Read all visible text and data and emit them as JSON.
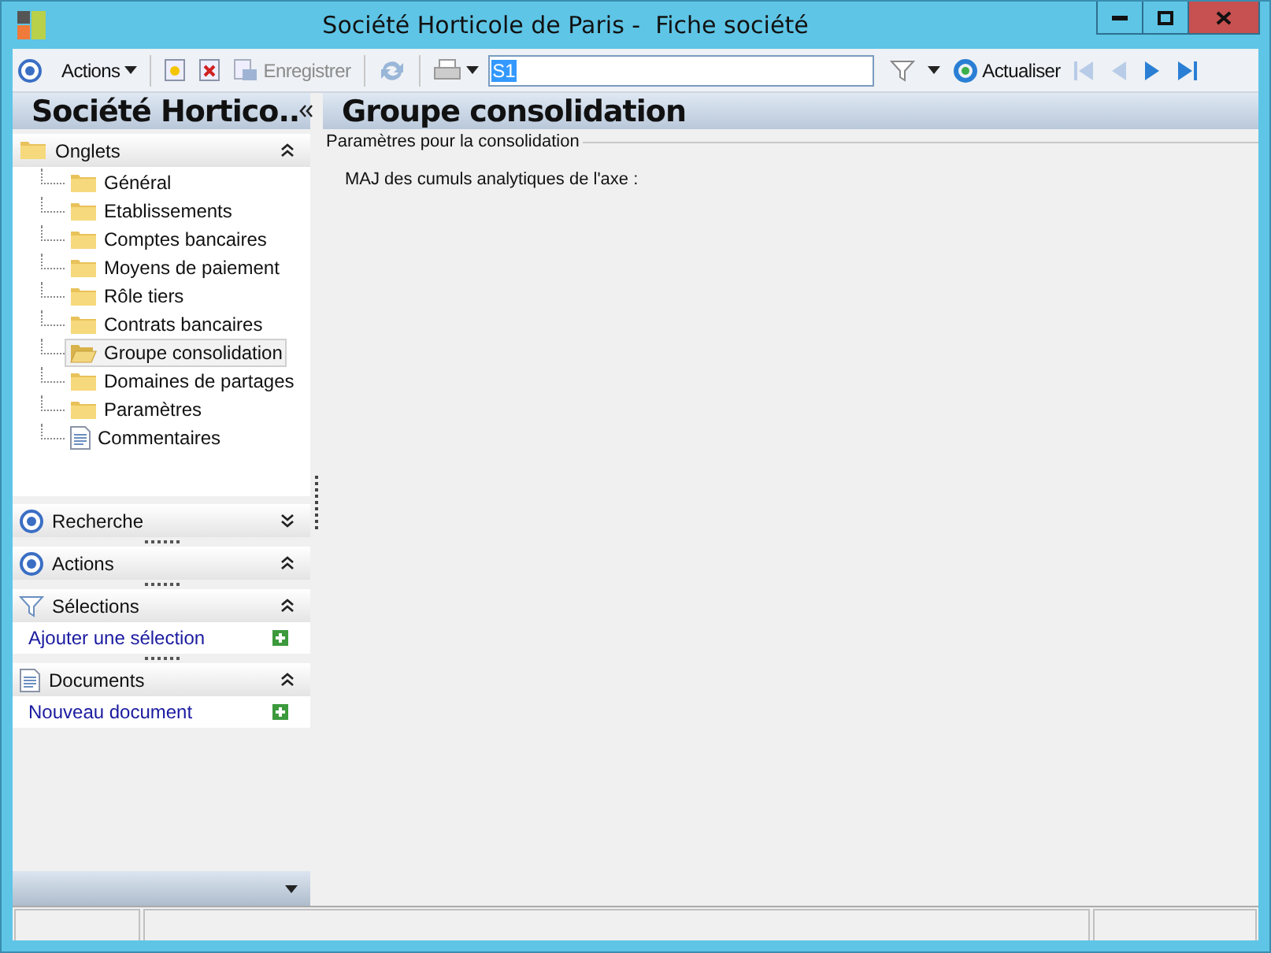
{
  "window": {
    "title": "Société Horticole de Paris -  Fiche société"
  },
  "toolbar": {
    "actions": "Actions",
    "save": "Enregistrer",
    "search_value": "S1",
    "refresh": "Actualiser"
  },
  "sidebar": {
    "title": "Société Hortico..",
    "tabs_section": {
      "title": "Onglets",
      "expanded": true,
      "items": [
        {
          "label": "Général",
          "kind": "folder",
          "selected": false
        },
        {
          "label": "Etablissements",
          "kind": "folder",
          "selected": false
        },
        {
          "label": "Comptes bancaires",
          "kind": "folder",
          "selected": false
        },
        {
          "label": "Moyens de paiement",
          "kind": "folder",
          "selected": false
        },
        {
          "label": "Rôle tiers",
          "kind": "folder",
          "selected": false
        },
        {
          "label": "Contrats bancaires",
          "kind": "folder",
          "selected": false
        },
        {
          "label": "Groupe consolidation",
          "kind": "folder",
          "selected": true
        },
        {
          "label": "Domaines de partages",
          "kind": "folder",
          "selected": false
        },
        {
          "label": "Paramètres",
          "kind": "folder",
          "selected": false
        },
        {
          "label": "Commentaires",
          "kind": "document",
          "selected": false
        }
      ]
    },
    "panels": [
      {
        "title": "Recherche",
        "kind": "target",
        "expanded": false
      },
      {
        "title": "Actions",
        "kind": "target",
        "expanded": true
      },
      {
        "title": "Sélections",
        "kind": "filter",
        "expanded": true,
        "link": "Ajouter une sélection"
      },
      {
        "title": "Documents",
        "kind": "document",
        "expanded": true,
        "link": "Nouveau document"
      }
    ]
  },
  "content": {
    "title": "Groupe consolidation",
    "group": "Paramètres pour la consolidation",
    "field_label": "MAJ des cumuls analytiques de l'axe :"
  }
}
